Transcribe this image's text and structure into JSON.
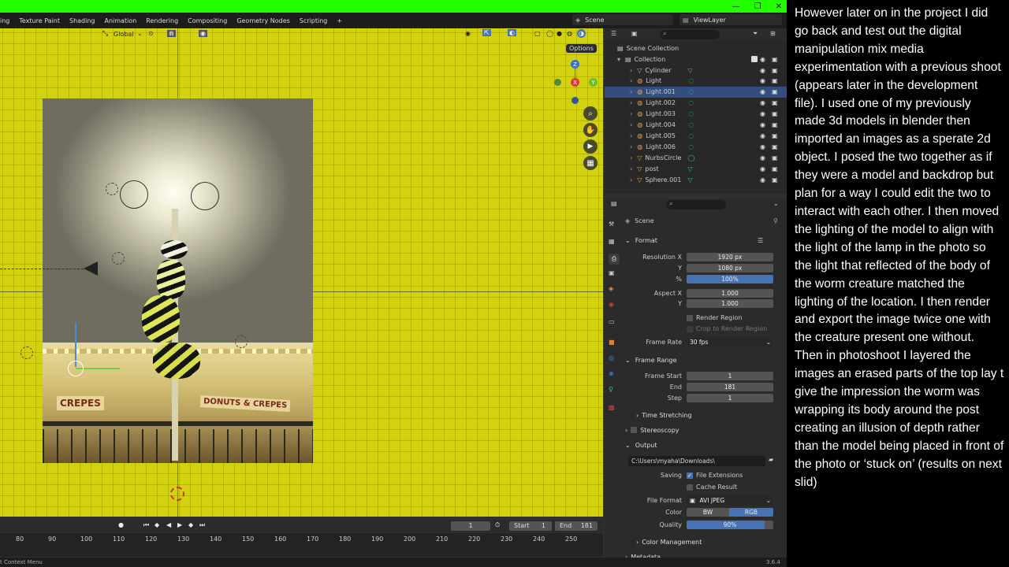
{
  "window": {
    "controls": [
      "—",
      "❐",
      "✕"
    ]
  },
  "topbar": {
    "workspaces": [
      "ing",
      "Texture Paint",
      "Shading",
      "Animation",
      "Rendering",
      "Compositing",
      "Geometry Nodes",
      "Scripting",
      "+"
    ],
    "scene_name": "Scene",
    "view_layer": "ViewLayer"
  },
  "viewport": {
    "orientation": "Global",
    "options_label": "Options",
    "axes": {
      "x": "X",
      "y": "Y",
      "z": "Z"
    },
    "photo_signs": [
      "CREPES",
      "DONUTS & CREPES"
    ]
  },
  "outliner": {
    "root": "Scene Collection",
    "collection": "Collection",
    "items": [
      {
        "name": "Cylinder",
        "selected": false
      },
      {
        "name": "Light",
        "selected": false
      },
      {
        "name": "Light.001",
        "selected": true
      },
      {
        "name": "Light.002",
        "selected": false
      },
      {
        "name": "Light.003",
        "selected": false
      },
      {
        "name": "Light.004",
        "selected": false
      },
      {
        "name": "Light.005",
        "selected": false
      },
      {
        "name": "Light.006",
        "selected": false
      },
      {
        "name": "NurbsCircle",
        "selected": false
      },
      {
        "name": "post",
        "selected": false
      },
      {
        "name": "Sphere.001",
        "selected": false
      }
    ]
  },
  "properties": {
    "context": "Scene",
    "format": {
      "title": "Format",
      "res_x_label": "Resolution X",
      "res_x": "1920 px",
      "res_y_label": "Y",
      "res_y": "1080 px",
      "percent_label": "%",
      "percent": "100%",
      "aspect_x_label": "Aspect X",
      "aspect_x": "1.000",
      "aspect_y_label": "Y",
      "aspect_y": "1.000",
      "render_region": "Render Region",
      "crop_region": "Crop to Render Region",
      "frame_rate_label": "Frame Rate",
      "frame_rate": "30 fps"
    },
    "frame_range": {
      "title": "Frame Range",
      "start_label": "Frame Start",
      "start": "1",
      "end_label": "End",
      "end": "181",
      "step_label": "Step",
      "step": "1"
    },
    "time_stretching": "Time Stretching",
    "stereoscopy": "Stereoscopy",
    "output": {
      "title": "Output",
      "path": "C:\\Users\\myaha\\Downloads\\",
      "saving_label": "Saving",
      "file_extensions": "File Extensions",
      "cache_result": "Cache Result",
      "file_format_label": "File Format",
      "file_format": "AVI JPEG",
      "color_label": "Color",
      "color_bw": "BW",
      "color_rgb": "RGB",
      "quality_label": "Quality",
      "quality": "90%"
    },
    "color_management": "Color Management",
    "metadata": "Metadata"
  },
  "timeline": {
    "current_frame": "1",
    "start_label": "Start",
    "start": "1",
    "end_label": "End",
    "end": "181",
    "ticks": [
      "80",
      "90",
      "100",
      "110",
      "120",
      "130",
      "140",
      "150",
      "160",
      "170",
      "180",
      "190",
      "200",
      "210",
      "220",
      "230",
      "240",
      "250"
    ]
  },
  "statusbar": {
    "left": "t Context Menu",
    "version": "3.6.4"
  },
  "text_panel": {
    "body": "However later on in the project I did go back and test out the digital manipulation mix media experimentation with a previous shoot (appears later in the development file).  I used one of my previously made 3d models in blender then imported an images as a sperate 2d object.  I posed the two together as if they were a model and backdrop but plan for a way I could edit the two to interact with each other. I then moved the lighting of the model to align with the light of the lamp in the photo so the light that reflected of  the body of the worm creature matched the lighting of the location. I then render and export the image twice one with the creature present one without. Then in photoshoot I layered the images an erased parts of the top lay t give the impression the worm was wrapping its body around the post creating an illusion of depth rather than the model being placed in front of the photo or ‘stuck on’ (results on next slid)"
  },
  "colors": {
    "viewport_bg": "#d2d211",
    "selection_blue": "#334d80",
    "field_blue": "#4772b3",
    "title_bar_green": "#22ff00"
  }
}
